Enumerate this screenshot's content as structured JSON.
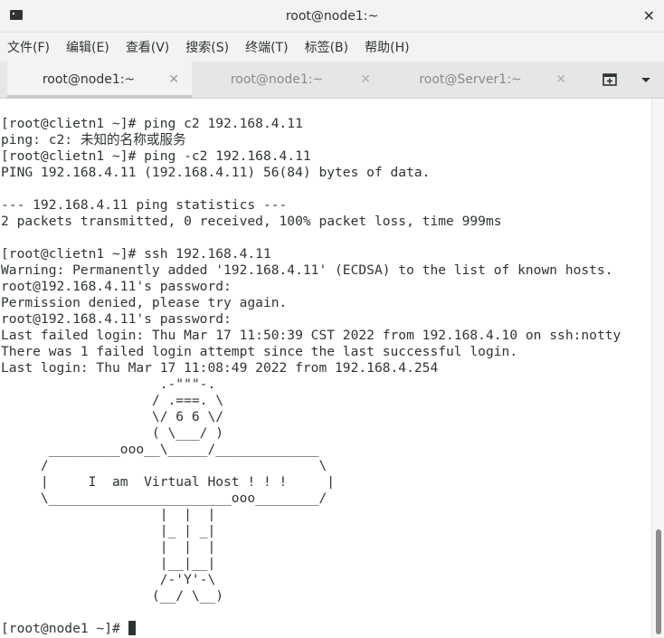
{
  "window": {
    "title": "root@node1:~",
    "close_glyph": "✕"
  },
  "menu": {
    "items": [
      "文件(F)",
      "编辑(E)",
      "查看(V)",
      "搜索(S)",
      "终端(T)",
      "标签(B)",
      "帮助(H)"
    ]
  },
  "tabs": [
    {
      "label": "root@node1:~",
      "active": true
    },
    {
      "label": "root@node1:~",
      "active": false
    },
    {
      "label": "root@Server1:~",
      "active": false
    }
  ],
  "tab_close_glyph": "✕",
  "terminal": {
    "lines": [
      "[root@clietn1 ~]# ping c2 192.168.4.11",
      "ping: c2: 未知的名称或服务",
      "[root@clietn1 ~]# ping -c2 192.168.4.11",
      "PING 192.168.4.11 (192.168.4.11) 56(84) bytes of data.",
      "",
      "--- 192.168.4.11 ping statistics ---",
      "2 packets transmitted, 0 received, 100% packet loss, time 999ms",
      "",
      "[root@clietn1 ~]# ssh 192.168.4.11",
      "Warning: Permanently added '192.168.4.11' (ECDSA) to the list of known hosts.",
      "root@192.168.4.11's password:",
      "Permission denied, please try again.",
      "root@192.168.4.11's password:",
      "Last failed login: Thu Mar 17 11:50:39 CST 2022 from 192.168.4.10 on ssh:notty",
      "There was 1 failed login attempt since the last successful login.",
      "Last login: Thu Mar 17 11:08:49 2022 from 192.168.4.254",
      "                    .-\"\"\"-.",
      "                   / .===. \\",
      "                   \\/ 6 6 \\/",
      "                   ( \\___/ )",
      "      _________ooo__\\_____/_____________",
      "     /                                  \\",
      "     |     I  am  Virtual Host ! ! !     |",
      "     \\_______________________ooo________/",
      "                    |  |  |",
      "                    |_ | _|",
      "                    |  |  |",
      "                    |__|__|",
      "                    /-'Y'-\\",
      "                   (__/ \\__)"
    ],
    "prompt": "[root@node1 ~]# "
  },
  "scrollbar": {
    "position_fraction": 0.8,
    "visible_fraction": 0.2
  }
}
